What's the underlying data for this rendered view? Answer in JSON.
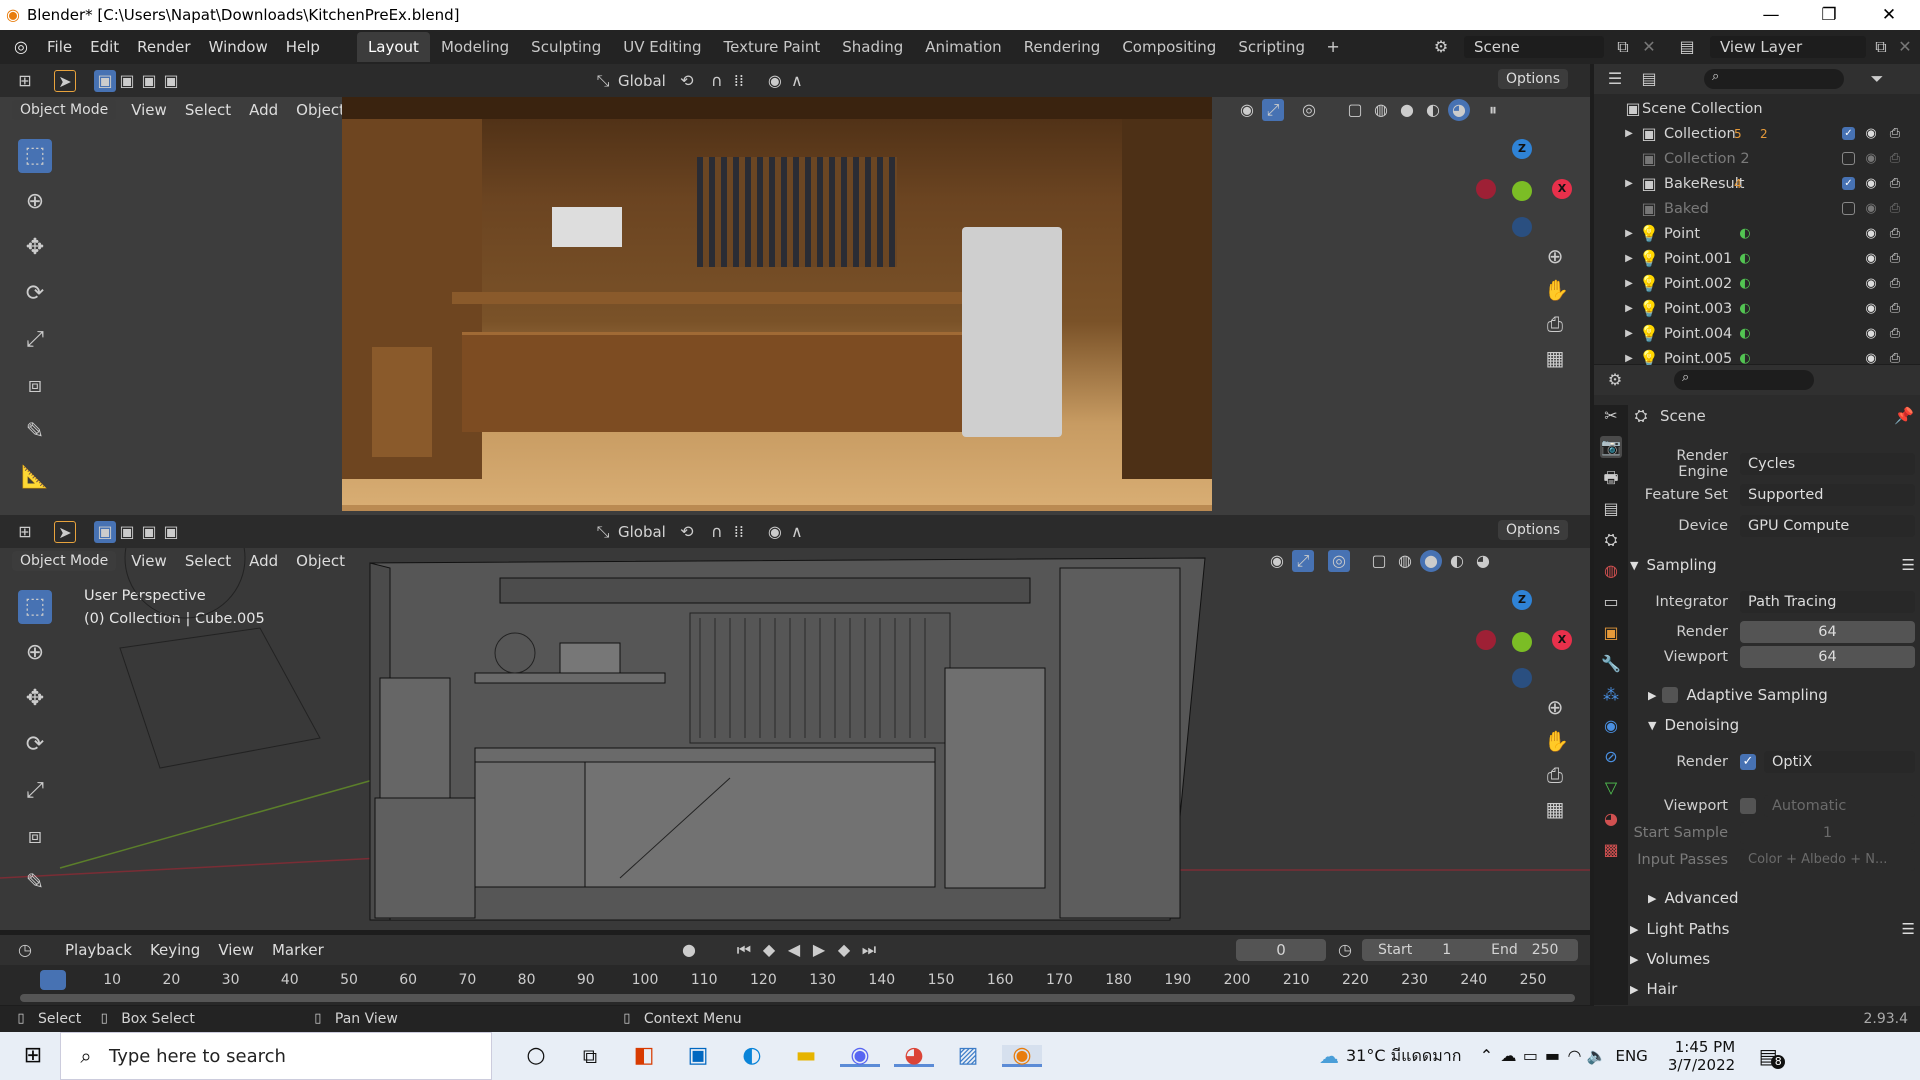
{
  "window": {
    "title": "Blender* [C:\\Users\\Napat\\Downloads\\KitchenPreEx.blend]"
  },
  "menu": [
    "File",
    "Edit",
    "Render",
    "Window",
    "Help"
  ],
  "workspaces": [
    "Layout",
    "Modeling",
    "Sculpting",
    "UV Editing",
    "Texture Paint",
    "Shading",
    "Animation",
    "Rendering",
    "Compositing",
    "Scripting"
  ],
  "active_workspace": "Layout",
  "scene_name": "Scene",
  "view_layer": "View Layer",
  "viewport_top": {
    "mode": "Object Mode",
    "menus": [
      "View",
      "Select",
      "Add",
      "Object"
    ],
    "orientation": "Global",
    "options": "Options"
  },
  "viewport_bottom": {
    "mode": "Object Mode",
    "menus": [
      "View",
      "Select",
      "Add",
      "Object"
    ],
    "orientation": "Global",
    "options": "Options",
    "overlay_title": "User Perspective",
    "overlay_sub": "(0) Collection | Cube.005"
  },
  "outliner": {
    "root": "Scene Collection",
    "rows": [
      {
        "label": "Collection",
        "dim": false,
        "badge1": "5",
        "badge2": "2"
      },
      {
        "label": "Collection 2",
        "dim": true
      },
      {
        "label": "BakeResult",
        "dim": false,
        "badge1": "4"
      },
      {
        "label": "Baked",
        "dim": true
      },
      {
        "label": "Point",
        "dim": false
      },
      {
        "label": "Point.001",
        "dim": false
      },
      {
        "label": "Point.002",
        "dim": false
      },
      {
        "label": "Point.003",
        "dim": false
      },
      {
        "label": "Point.004",
        "dim": false
      },
      {
        "label": "Point.005",
        "dim": false
      }
    ]
  },
  "properties": {
    "context": "Scene",
    "render_engine": {
      "label": "Render Engine",
      "value": "Cycles"
    },
    "feature_set": {
      "label": "Feature Set",
      "value": "Supported"
    },
    "device": {
      "label": "Device",
      "value": "GPU Compute"
    },
    "sampling": "Sampling",
    "integrator": {
      "label": "Integrator",
      "value": "Path Tracing"
    },
    "render_samples": {
      "label": "Render",
      "value": "64"
    },
    "viewport_samples": {
      "label": "Viewport",
      "value": "64"
    },
    "adaptive": "Adaptive Sampling",
    "denoising": "Denoising",
    "den_render": {
      "label": "Render",
      "value": "OptiX"
    },
    "den_viewport": {
      "label": "Viewport",
      "value": "Automatic"
    },
    "start_sample": {
      "label": "Start Sample",
      "value": "1"
    },
    "input_passes": {
      "label": "Input Passes",
      "value": "Color + Albedo + N..."
    },
    "advanced": "Advanced",
    "light_paths": "Light Paths",
    "volumes": "Volumes",
    "hair": "Hair"
  },
  "timeline": {
    "menus": [
      "Playback",
      "Keying",
      "View",
      "Marker"
    ],
    "current": "0",
    "start_label": "Start",
    "start": "1",
    "end_label": "End",
    "end": "250",
    "ticks": [
      "0",
      "10",
      "20",
      "30",
      "40",
      "50",
      "60",
      "70",
      "80",
      "90",
      "100",
      "110",
      "120",
      "130",
      "140",
      "150",
      "160",
      "170",
      "180",
      "190",
      "200",
      "210",
      "220",
      "230",
      "240",
      "250"
    ]
  },
  "statusbar": {
    "select": "Select",
    "box_select": "Box Select",
    "pan_view": "Pan View",
    "context_menu": "Context Menu",
    "version": "2.93.4"
  },
  "taskbar": {
    "search_placeholder": "Type here to search",
    "weather": "31°C มีแดดมาก",
    "lang": "ENG",
    "time": "1:45 PM",
    "date": "3/7/2022",
    "notif": "8"
  },
  "colors": {
    "accent": "#4772b3",
    "axis_x": "#e8304b",
    "axis_y": "#7bbd25",
    "axis_z": "#2f83d6"
  }
}
